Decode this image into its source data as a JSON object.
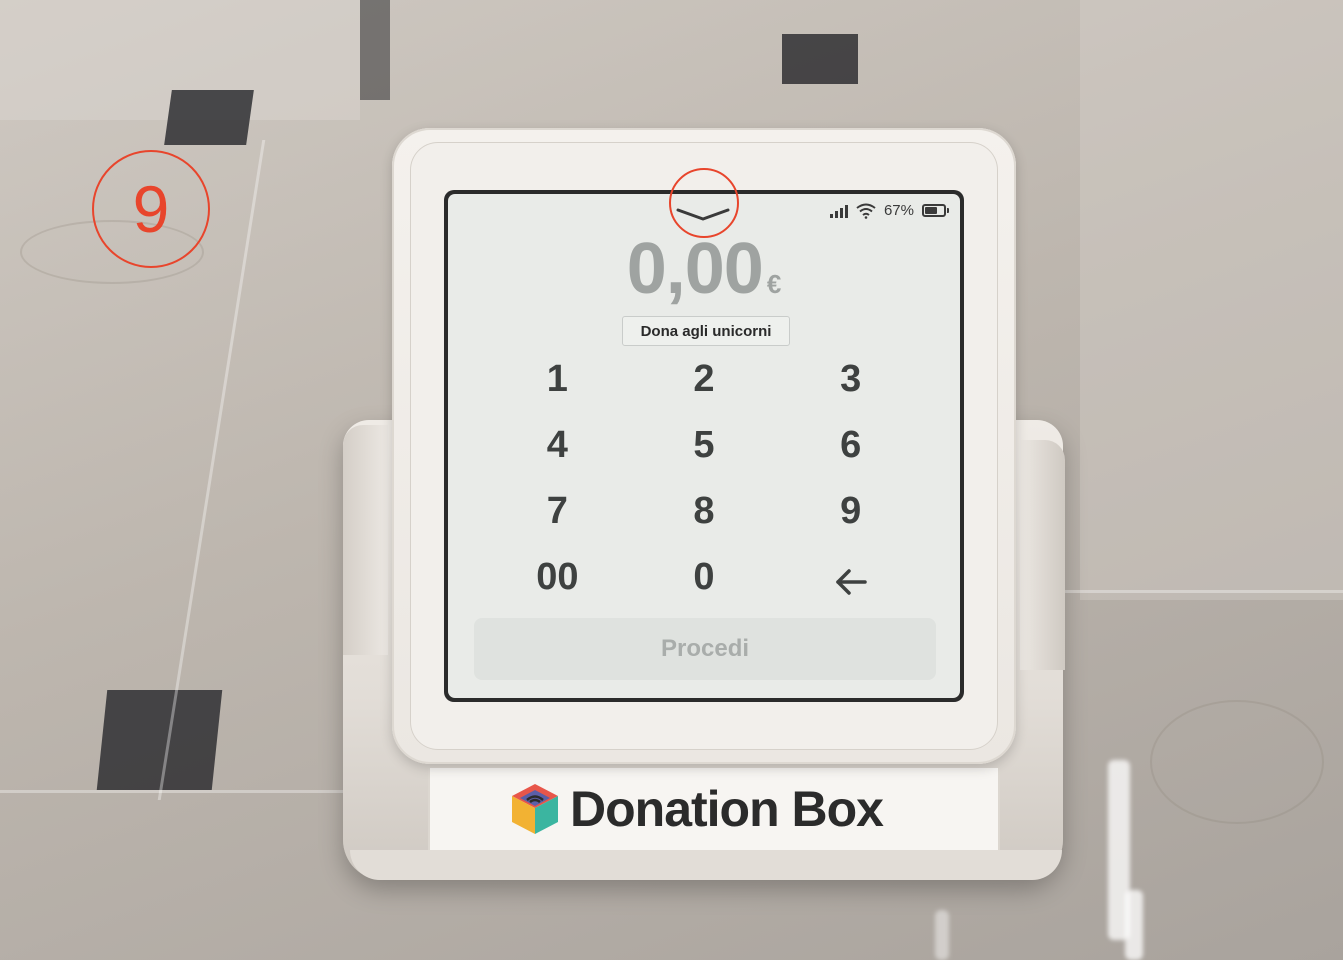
{
  "annotation": {
    "step_number": "9",
    "color": "#e8452c"
  },
  "status_bar": {
    "battery_percent_label": "67%",
    "battery_level": 0.67,
    "icons": [
      "signal-icon",
      "wifi-icon",
      "battery-icon"
    ]
  },
  "screen": {
    "top_handle_icon": "chevron-down-icon",
    "amount_value": "0,00",
    "amount_currency": "€",
    "campaign_label": "Dona agli unicorni",
    "keypad": [
      "1",
      "2",
      "3",
      "4",
      "5",
      "6",
      "7",
      "8",
      "9",
      "00",
      "0",
      "←"
    ],
    "proceed_label": "Procedi"
  },
  "brand": {
    "name": "Donation Box",
    "logo_icon": "donation-box-logo-icon"
  },
  "colors": {
    "amount": "#9fa3a1",
    "keys": "#3e4140",
    "screen_bg": "#e9ebe8",
    "proceed_bg": "#dfe2df",
    "proceed_text": "#a9adab",
    "annotation": "#e8452c"
  }
}
